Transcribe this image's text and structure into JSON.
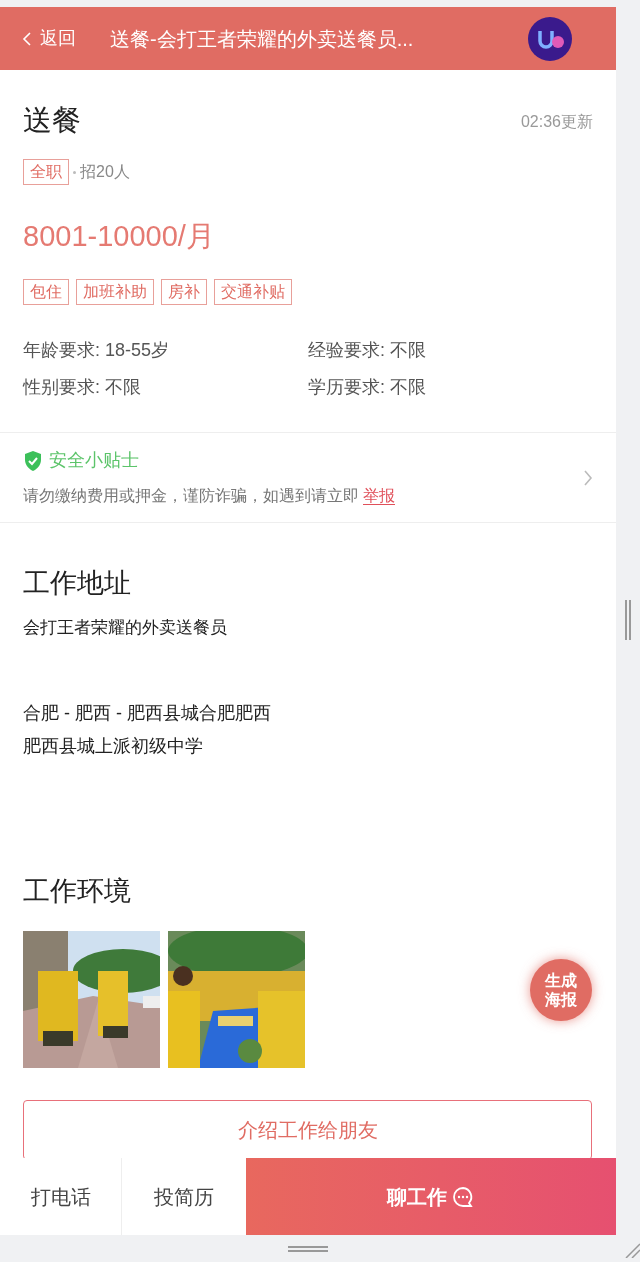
{
  "header": {
    "back_label": "返回",
    "title": "送餐-会打王者荣耀的外卖送餐员..."
  },
  "job": {
    "title": "送餐",
    "updated": "02:36更新",
    "type_tag": "全职",
    "headcount": "招20人",
    "salary": "8001-10000/月",
    "benefits": [
      "包住",
      "加班补助",
      "房补",
      "交通补贴"
    ],
    "requirements": [
      "年龄要求: 18-55岁",
      "经验要求: 不限",
      "性别要求: 不限",
      "学历要求: 不限"
    ]
  },
  "safety_tip": {
    "title": "安全小贴士",
    "text": "请勿缴纳费用或押金，谨防诈骗，如遇到请立即",
    "link": "举报"
  },
  "work_address": {
    "heading": "工作地址",
    "company": "会打王者荣耀的外卖送餐员",
    "address_lines": [
      "合肥 - 肥西 - 肥西县城合肥肥西",
      "肥西县城上派初级中学"
    ]
  },
  "work_environment": {
    "heading": "工作环境"
  },
  "poster_button": {
    "label": "生成海报"
  },
  "share_button": {
    "label": "介绍工作给朋友"
  },
  "bottom_bar": {
    "call": "打电话",
    "resume": "投简历",
    "chat": "聊工作"
  }
}
